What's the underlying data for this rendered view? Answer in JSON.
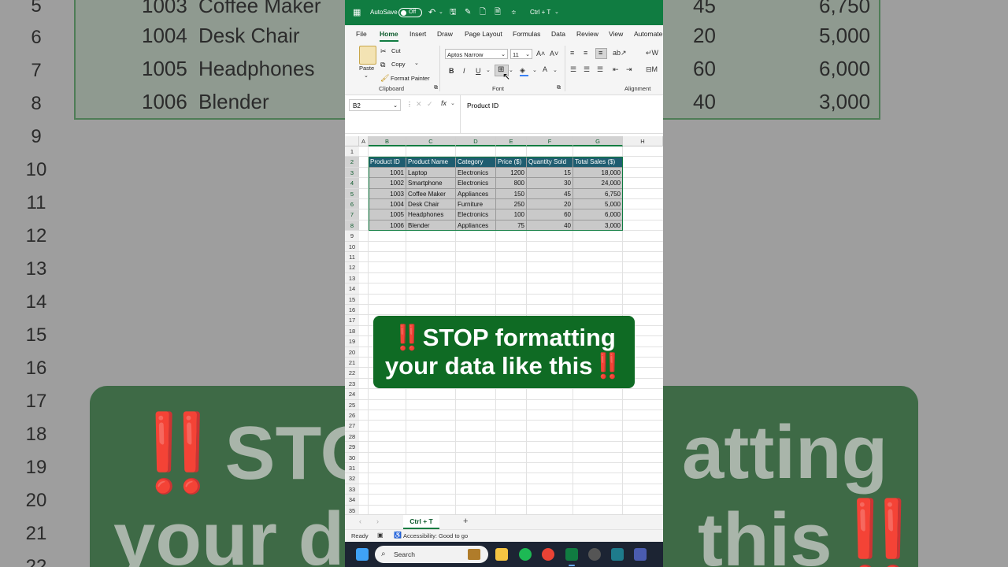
{
  "background": {
    "rows": [
      {
        "num": "5",
        "id": "1003",
        "name": "Coffee Maker",
        "qty": "45",
        "total": "6,750"
      },
      {
        "num": "6",
        "id": "1004",
        "name": "Desk Chair",
        "qty": "20",
        "total": "5,000"
      },
      {
        "num": "7",
        "id": "1005",
        "name": "Headphones",
        "qty": "60",
        "total": "6,000"
      },
      {
        "num": "8",
        "id": "1006",
        "name": "Blender",
        "qty": "40",
        "total": "3,000"
      }
    ],
    "row_numbers": [
      "9",
      "10",
      "11",
      "12",
      "13",
      "14",
      "15",
      "16",
      "17",
      "18",
      "19",
      "20",
      "21",
      "22"
    ],
    "banner_line1_a": "‼️",
    "banner_line1_b": "STO",
    "banner_line1_c": "atting",
    "banner_line2_a": "your d",
    "banner_line2_b": "this",
    "banner_line2_c": "‼️"
  },
  "titlebar": {
    "autosave": "AutoSave",
    "toggle": "Off",
    "title": "Ctrl + T"
  },
  "menu": [
    "File",
    "Home",
    "Insert",
    "Draw",
    "Page Layout",
    "Formulas",
    "Data",
    "Review",
    "View",
    "Automate"
  ],
  "ribbon": {
    "paste": "Paste",
    "cut": "Cut",
    "copy": "Copy",
    "format_painter": "Format Painter",
    "clipboard": "Clipboard",
    "font_name": "Aptos Narrow",
    "font_size": "11",
    "font": "Font",
    "alignment": "Alignment",
    "bold": "B",
    "italic": "I",
    "underline": "U"
  },
  "formula_bar": {
    "name_box": "B2",
    "fx": "fx",
    "value": "Product ID"
  },
  "sheet": {
    "columns": [
      "A",
      "B",
      "C",
      "D",
      "E",
      "F",
      "G",
      "H"
    ],
    "header": [
      "Product ID",
      "Product Name",
      "Category",
      "Price ($)",
      "Quantity Sold",
      "Total Sales ($)"
    ],
    "rows": [
      [
        "1001",
        "Laptop",
        "Electronics",
        "1200",
        "15",
        "18,000"
      ],
      [
        "1002",
        "Smartphone",
        "Electronics",
        "800",
        "30",
        "24,000"
      ],
      [
        "1003",
        "Coffee Maker",
        "Appliances",
        "150",
        "45",
        "6,750"
      ],
      [
        "1004",
        "Desk Chair",
        "Furniture",
        "250",
        "20",
        "5,000"
      ],
      [
        "1005",
        "Headphones",
        "Electronics",
        "100",
        "60",
        "6,000"
      ],
      [
        "1006",
        "Blender",
        "Appliances",
        "75",
        "40",
        "3,000"
      ]
    ],
    "row_numbers": [
      "1",
      "2",
      "3",
      "4",
      "5",
      "6",
      "7",
      "8",
      "9",
      "10",
      "11",
      "12",
      "13",
      "14",
      "15",
      "16",
      "17",
      "18",
      "19",
      "20",
      "21",
      "22",
      "23",
      "24",
      "25",
      "26",
      "27",
      "28",
      "29",
      "30",
      "31",
      "32",
      "33",
      "34",
      "35"
    ]
  },
  "overlay": {
    "line1_bang": "‼️",
    "line1": "STOP formatting",
    "line2": "your data like this",
    "line2_bang": "‼️"
  },
  "tabs": {
    "sheet_tab": "Ctrl + T",
    "add": "+"
  },
  "status": {
    "ready": "Ready",
    "accessibility": "Accessibility: Good to go"
  },
  "taskbar": {
    "search": "Search"
  },
  "colors": {
    "excel_green": "#107c41",
    "table_header": "#1f5d70",
    "banner": "#0f6b24"
  }
}
